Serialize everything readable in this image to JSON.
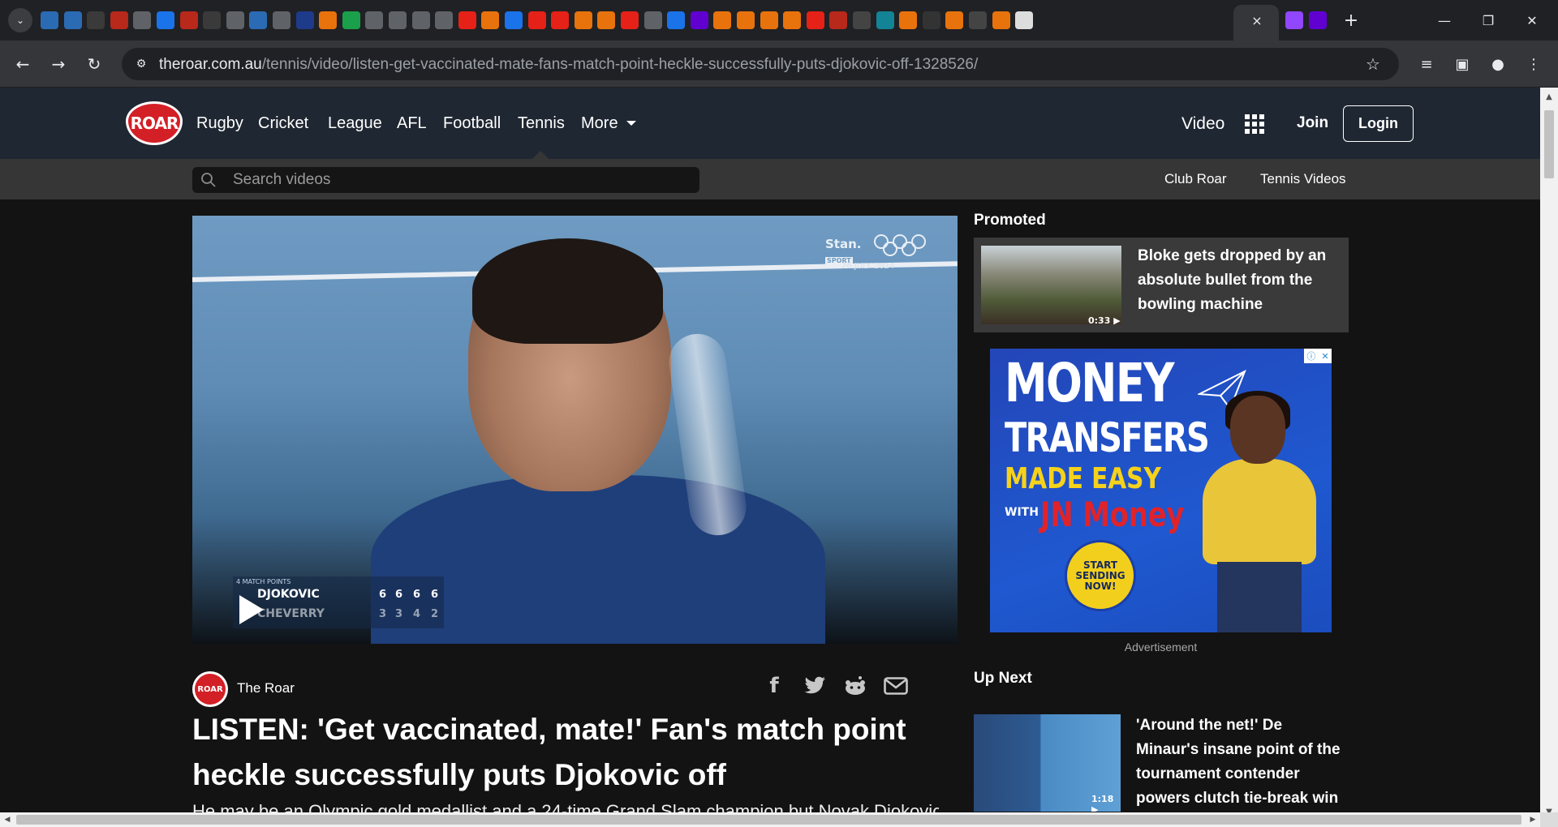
{
  "browser": {
    "tab_count_icons": [
      "tab-search",
      "shield",
      "shield",
      "play",
      "bi",
      "globe",
      "search",
      "bi",
      "play",
      "globe",
      "shield",
      "globe",
      "cube",
      "shield-orange",
      "g",
      "globe",
      "tm",
      "globe",
      "globe",
      "youtube",
      "bookmark",
      "search",
      "youtube",
      "mic",
      "bookmark",
      "bookmark",
      "youtube",
      "tm",
      "c",
      "yahoo",
      "bookmark",
      "bookmark",
      "bookmark",
      "bookmark",
      "youtube",
      "bi",
      "r",
      "s",
      "bookmark",
      "spider",
      "bookmark",
      "o",
      "bookmark",
      "paper",
      "roar-active",
      "twitch",
      "yahoo"
    ],
    "active_tab_close": "×",
    "new_tab": "+",
    "url_host": "theroar.com.au",
    "url_path": "/tennis/video/listen-get-vaccinated-mate-fans-match-point-heckle-successfully-puts-djokovic-off-1328526/"
  },
  "header": {
    "logo_text": "ROAR",
    "nav": [
      "Rugby",
      "Cricket",
      "League",
      "AFL",
      "Football",
      "Tennis",
      "More"
    ],
    "video_label": "Video",
    "join_label": "Join",
    "login_label": "Login"
  },
  "subheader": {
    "search_placeholder": "Search videos",
    "links": [
      "Club Roar",
      "Tennis Videos"
    ]
  },
  "video": {
    "broadcaster": "Stan.",
    "broadcaster_sub": "SPORT",
    "date_overlay": "26 JULY 2024",
    "scoreboard_title": "4 MATCH POINTS",
    "player1": "DJOKOVIC",
    "player2": "CHEVERRY",
    "p1_scores": [
      "6",
      "6",
      "6",
      "6"
    ],
    "p2_scores": [
      "3",
      "3",
      "4",
      "2"
    ]
  },
  "article": {
    "author": "The Roar",
    "author_avatar_text": "ROAR",
    "headline": "LISTEN: 'Get vaccinated, mate!' Fan's match point heckle successfully puts Djokovic off",
    "teaser": "He may be an Olympic gold medallist and a 24-time Grand Slam champion but Novak Djokovic has shown he is..."
  },
  "sidebar": {
    "promoted_heading": "Promoted",
    "promo_duration": "0:33 ▶",
    "promo_title": "Bloke gets dropped by an absolute bullet from the bowling machine",
    "ad": {
      "line1": "MONEY",
      "line2": "TRANSFERS",
      "line3": "MADE EASY",
      "with": "WITH",
      "brand": "JN Money",
      "cta": "START SENDING NOW!",
      "badge_info": "ⓘ",
      "badge_close": "✕"
    },
    "ad_label": "Advertisement",
    "up_next_heading": "Up Next",
    "next_duration": "1:18 ▶",
    "next_title": "'Around the net!' De Minaur's insane point of the tournament contender powers clutch tie-break win"
  },
  "colors": {
    "header_bg": "#1f2732",
    "subheader_bg": "#363636",
    "page_bg": "#131313",
    "logo_red": "#d31f26"
  }
}
